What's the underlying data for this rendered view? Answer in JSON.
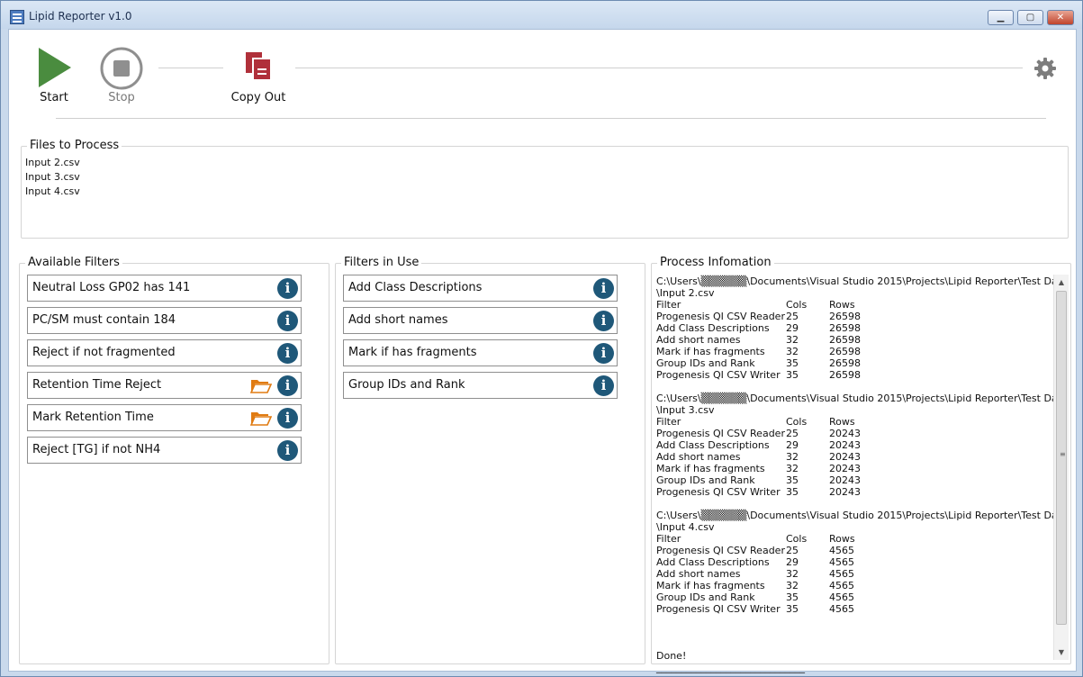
{
  "window": {
    "title": "Lipid Reporter v1.0",
    "controls": {
      "minimize": "▁",
      "maximize": "▢",
      "close": "✕"
    }
  },
  "toolbar": {
    "start_label": "Start",
    "stop_label": "Stop",
    "copy_label": "Copy Out",
    "icons": {
      "start": "play-icon",
      "stop": "stop-icon",
      "copy": "copy-documents-icon",
      "settings": "gear-icon"
    },
    "colors": {
      "start": "#4a8c3f",
      "stop": "#8f8f8f",
      "copy": "#b0303a",
      "settings": "#7d7d7d"
    }
  },
  "files_to_process": {
    "title": "Files to Process",
    "files": [
      "Input 2.csv",
      "Input 3.csv",
      "Input 4.csv"
    ]
  },
  "available_filters": {
    "title": "Available Filters",
    "items": [
      {
        "label": "Neutral Loss GP02 has 141",
        "has_folder": false
      },
      {
        "label": "PC/SM must contain 184",
        "has_folder": false
      },
      {
        "label": "Reject if not fragmented",
        "has_folder": false
      },
      {
        "label": "Retention Time Reject",
        "has_folder": true
      },
      {
        "label": "Mark Retention Time",
        "has_folder": true
      },
      {
        "label": "Reject [TG] if not NH4",
        "has_folder": false
      }
    ]
  },
  "filters_in_use": {
    "title": "Filters in Use",
    "items": [
      {
        "label": "Add Class Descriptions"
      },
      {
        "label": "Add short names"
      },
      {
        "label": "Mark if has fragments"
      },
      {
        "label": "Group IDs and Rank"
      }
    ]
  },
  "process_information": {
    "title": "Process Infomation",
    "headers": [
      "Filter",
      "Cols",
      "Rows"
    ],
    "runs": [
      {
        "path_line1": "C:\\Users\\▒▒▒▒▒▒\\Documents\\Visual Studio 2015\\Projects\\Lipid Reporter\\Test Data",
        "path_line2": "\\Input 2.csv",
        "rows": [
          [
            "Progenesis QI CSV Reader",
            "25",
            "26598"
          ],
          [
            "Add Class Descriptions",
            "29",
            "26598"
          ],
          [
            "Add short names",
            "32",
            "26598"
          ],
          [
            "Mark if has fragments",
            "32",
            "26598"
          ],
          [
            "Group IDs and Rank",
            "35",
            "26598"
          ],
          [
            "Progenesis QI CSV Writer",
            "35",
            "26598"
          ]
        ]
      },
      {
        "path_line1": "C:\\Users\\▒▒▒▒▒▒\\Documents\\Visual Studio 2015\\Projects\\Lipid Reporter\\Test Data",
        "path_line2": "\\Input 3.csv",
        "rows": [
          [
            "Progenesis QI CSV Reader",
            "25",
            "20243"
          ],
          [
            "Add Class Descriptions",
            "29",
            "20243"
          ],
          [
            "Add short names",
            "32",
            "20243"
          ],
          [
            "Mark if has fragments",
            "32",
            "20243"
          ],
          [
            "Group IDs and Rank",
            "35",
            "20243"
          ],
          [
            "Progenesis QI CSV Writer",
            "35",
            "20243"
          ]
        ]
      },
      {
        "path_line1": "C:\\Users\\▒▒▒▒▒▒\\Documents\\Visual Studio 2015\\Projects\\Lipid Reporter\\Test Data",
        "path_line2": "\\Input 4.csv",
        "rows": [
          [
            "Progenesis QI CSV Reader",
            "25",
            "4565"
          ],
          [
            "Add Class Descriptions",
            "29",
            "4565"
          ],
          [
            "Add short names",
            "32",
            "4565"
          ],
          [
            "Mark if has fragments",
            "32",
            "4565"
          ],
          [
            "Group IDs and Rank",
            "35",
            "4565"
          ],
          [
            "Progenesis QI CSV Writer",
            "35",
            "4565"
          ]
        ]
      }
    ],
    "done_text": "Done!",
    "separator": "______________________________"
  },
  "colors": {
    "info_icon": "#1f5879",
    "folder_icon": "#e07b12"
  }
}
